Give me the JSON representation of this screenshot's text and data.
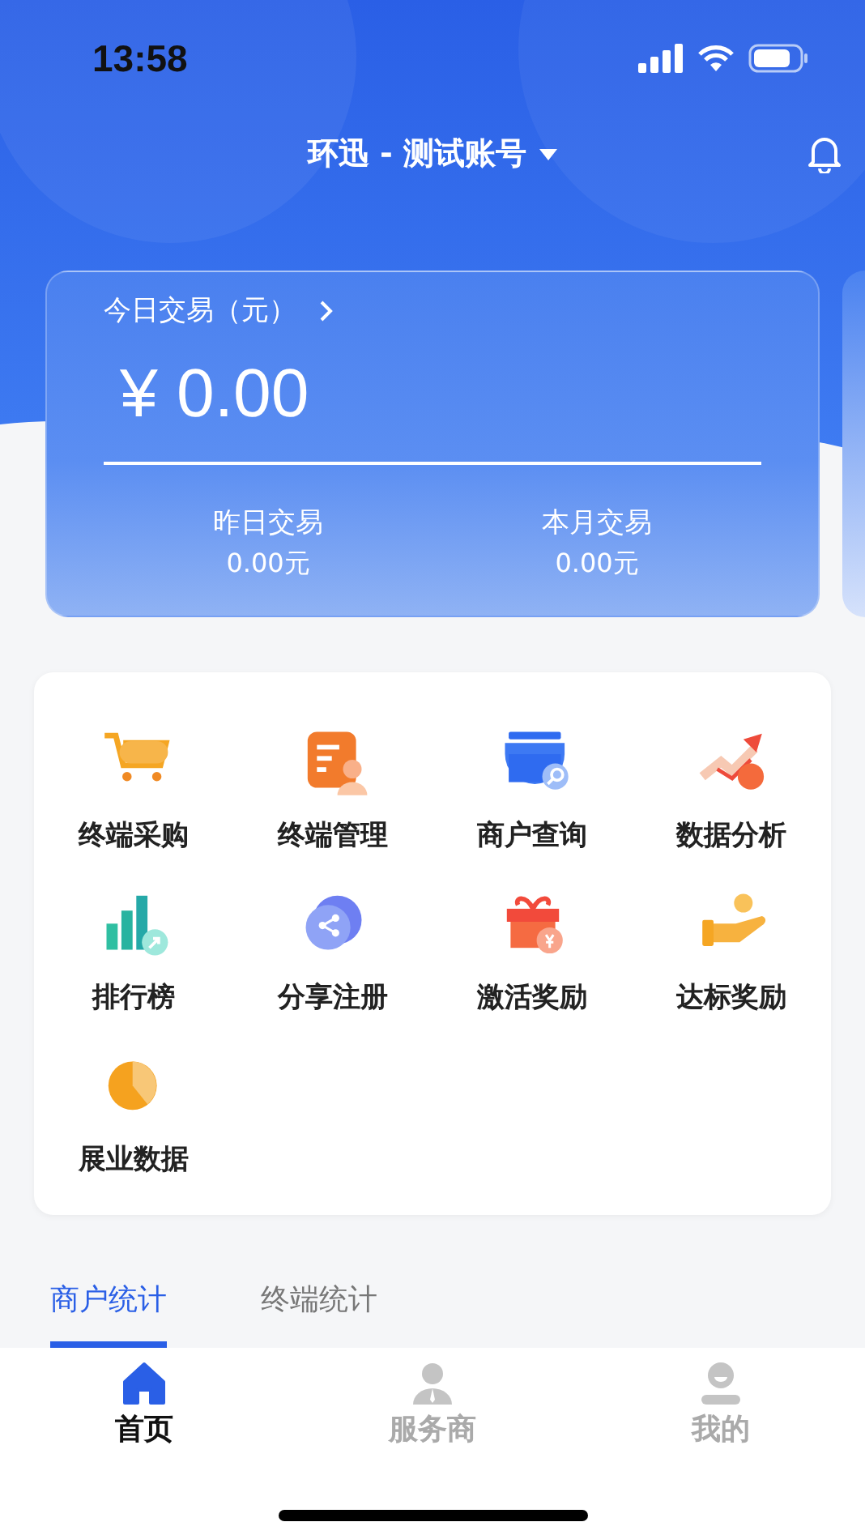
{
  "status_bar": {
    "time": "13:58"
  },
  "header": {
    "title": "环迅 - 测试账号"
  },
  "summary_card": {
    "title": "今日交易（元）",
    "amount": "¥ 0.00",
    "stats": [
      {
        "label": "昨日交易",
        "value": "0.00元"
      },
      {
        "label": "本月交易",
        "value": "0.00元"
      }
    ]
  },
  "menu": [
    {
      "label": "终端采购"
    },
    {
      "label": "终端管理"
    },
    {
      "label": "商户查询"
    },
    {
      "label": "数据分析"
    },
    {
      "label": "排行榜"
    },
    {
      "label": "分享注册"
    },
    {
      "label": "激活奖励"
    },
    {
      "label": "达标奖励"
    },
    {
      "label": "展业数据"
    }
  ],
  "stats_tabs": [
    {
      "label": "商户统计",
      "selected": true
    },
    {
      "label": "终端统计",
      "selected": false
    }
  ],
  "tab_bar": [
    {
      "label": "首页",
      "selected": true
    },
    {
      "label": "服务商",
      "selected": false
    },
    {
      "label": "我的",
      "selected": false
    }
  ]
}
